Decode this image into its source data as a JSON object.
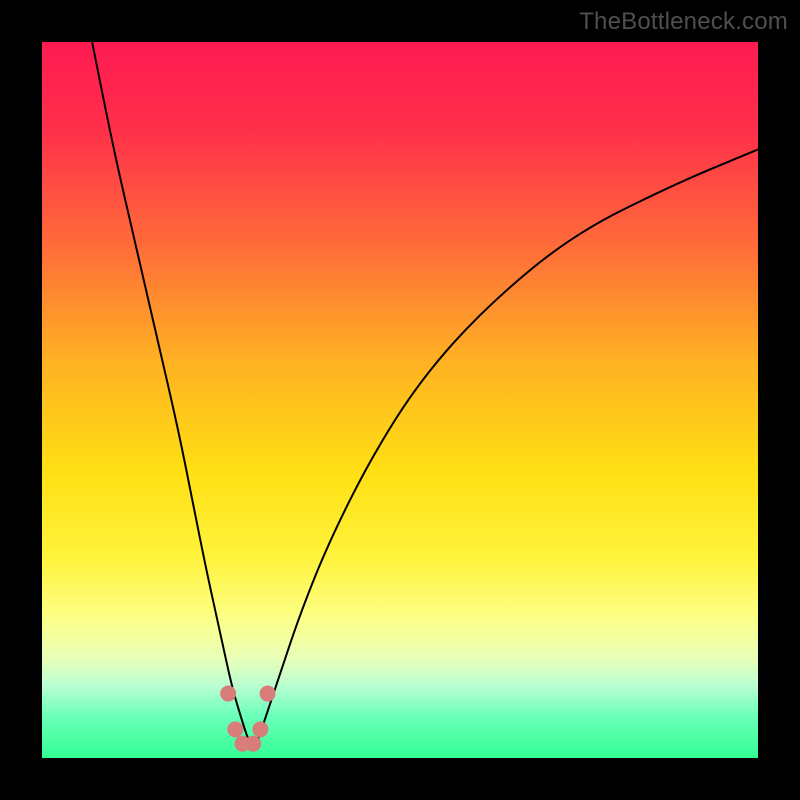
{
  "watermark": "TheBottleneck.com",
  "gradient": {
    "stops": [
      {
        "pct": 0,
        "color": "#ff1a52"
      },
      {
        "pct": 12,
        "color": "#ff2f4a"
      },
      {
        "pct": 28,
        "color": "#ff6a3a"
      },
      {
        "pct": 45,
        "color": "#ffb322"
      },
      {
        "pct": 60,
        "color": "#ffe014"
      },
      {
        "pct": 72,
        "color": "#fff33c"
      },
      {
        "pct": 80,
        "color": "#fdff82"
      },
      {
        "pct": 86,
        "color": "#e9ffb7"
      },
      {
        "pct": 90,
        "color": "#b9ffd2"
      },
      {
        "pct": 94,
        "color": "#6cffba"
      },
      {
        "pct": 100,
        "color": "#33ff94"
      }
    ]
  },
  "chart_data": {
    "type": "line",
    "title": "",
    "xlabel": "",
    "ylabel": "",
    "xlim": [
      0,
      100
    ],
    "ylim": [
      0,
      100
    ],
    "series": [
      {
        "name": "bottleneck-curve",
        "x": [
          7,
          10,
          13,
          16,
          19,
          21,
          23,
          25,
          26.5,
          28,
          29,
          30,
          31,
          33,
          36,
          40,
          46,
          53,
          62,
          74,
          88,
          100
        ],
        "y": [
          100,
          85,
          72,
          59,
          46,
          36,
          26,
          17,
          10,
          5,
          2,
          2,
          5,
          11,
          20,
          30,
          42,
          53,
          63,
          73,
          80,
          85
        ]
      }
    ],
    "markers": {
      "name": "highlight-dots",
      "points": [
        {
          "x": 26.0,
          "y": 9
        },
        {
          "x": 27.0,
          "y": 4
        },
        {
          "x": 28.0,
          "y": 2
        },
        {
          "x": 29.5,
          "y": 2
        },
        {
          "x": 30.5,
          "y": 4
        },
        {
          "x": 31.5,
          "y": 9
        }
      ],
      "radius_px": 8
    }
  }
}
